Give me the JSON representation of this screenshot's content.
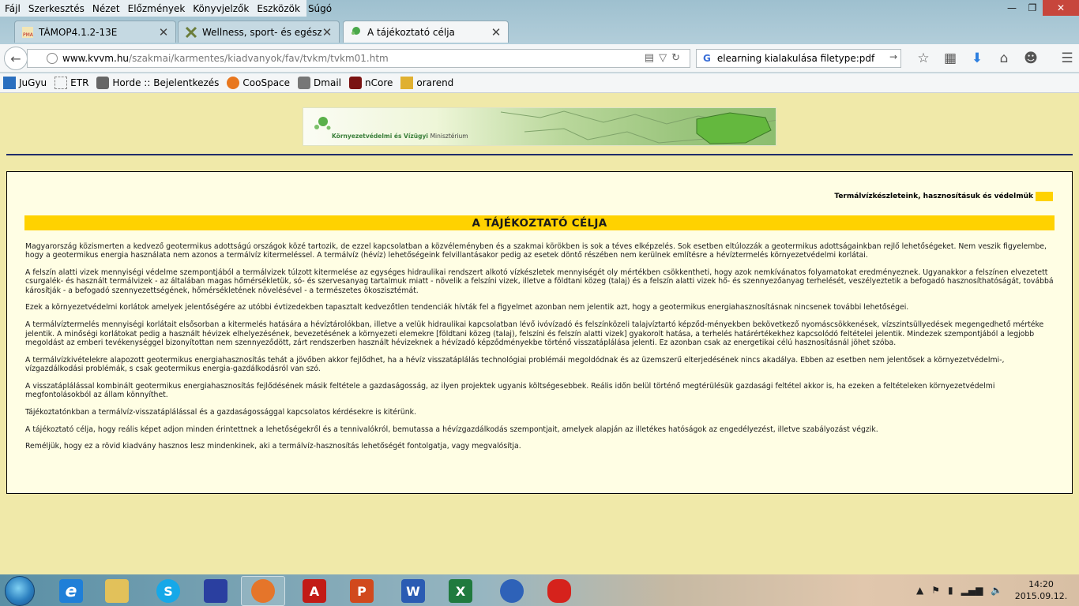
{
  "menu": [
    "Fájl",
    "Szerkesztés",
    "Nézet",
    "Előzmények",
    "Könyvjelzők",
    "Eszközök",
    "Súgó"
  ],
  "window_controls": {
    "minimize": "—",
    "restore": "❐",
    "close": "✕"
  },
  "tabs": [
    {
      "title": "TÁMOP4.1.2-13E",
      "icon": "pma-icon"
    },
    {
      "title": "Wellness, sport- és egészs...",
      "icon": "tools-icon"
    },
    {
      "title": "A tájékoztató célja",
      "icon": "leaf-icon",
      "active": true
    }
  ],
  "new_tab": "+",
  "url": {
    "host": "www.kvvm.hu",
    "path": "/szakmai/karmentes/kiadvanyok/fav/tvkm/tvkm01.htm"
  },
  "search": {
    "engine": "G",
    "value": "elearning kialakulása filetype:pdf",
    "go": "→"
  },
  "nav_icons": [
    "star-icon",
    "bookmarks-list-icon",
    "download-icon",
    "home-icon",
    "chat-icon",
    "menu-icon"
  ],
  "bookmarks": [
    {
      "label": "JuGyu",
      "color": "#2a6fbf"
    },
    {
      "label": "ETR",
      "color": "#ffffff"
    },
    {
      "label": "Horde :: Bejelentkezés",
      "color": "#666666"
    },
    {
      "label": "CooSpace",
      "color": "#e8771e"
    },
    {
      "label": "Dmail",
      "color": "#777777"
    },
    {
      "label": "nCore",
      "color": "#7a1212"
    },
    {
      "label": "orarend",
      "color": "#e0b030"
    }
  ],
  "banner": {
    "ministry": "Környezetvédelmi és Vízügyi",
    "ministry_suffix": "Minisztérium"
  },
  "series_title": "Termálvízkészleteink, hasznosításuk és védelmük",
  "heading": "A TÁJÉKOZTATÓ CÉLJA",
  "paragraphs": [
    "Magyarország közismerten a kedvező geotermikus adottságú országok közé tartozik, de ezzel kapcsolatban a közvéleményben és a szakmai körökben is sok a téves elképzelés. Sok esetben eltúlozzák a geotermikus adottságainkban rejlő lehetőségeket. Nem veszik figyelembe, hogy a geotermikus energia használata nem azonos a termálvíz kitermeléssel. A termálvíz (hévíz) lehetőségeink felvillantásakor pedig az esetek döntő részében nem kerülnek említésre a hévíztermelés környezetvédelmi korlátai.",
    "A felszín alatti vizek mennyiségi védelme szempontjából a termálvizek túlzott kitermelése az egységes hidraulikai rendszert alkotó vízkészletek mennyiségét oly mértékben csökkentheti, hogy azok nemkívánatos folyamatokat eredményeznek. Ugyanakkor a felszínen elvezetett csurgalék- és használt termálvizek - az általában magas hőmérsékletük, só- és szervesanyag tartalmuk miatt - növelik a felszíni vizek, illetve a földtani közeg (talaj) és a felszín alatti vizek hő- és szennyezőanyag terhelését, veszélyeztetik a befogadó hasznosíthatóságát, továbbá károsítják - a befogadó szennyezettségének, hőmérsékletének növelésével - a természetes ökoszisztémát.",
    "Ezek a környezetvédelmi korlátok  amelyek jelentőségére az utóbbi évtizedekben tapasztalt kedvezőtlen tendenciák hívták fel a figyelmet  azonban nem jelentik azt, hogy a geotermikus energiahasznosításnak nincsenek további lehetőségei.",
    "A termálvíztermelés mennyiségi korlátait elsősorban a kitermelés hatására a hévíztárolókban, illetve a velük hidraulikai kapcsolatban lévő ivóvízadó és felszínközeli talajvíztartó képződ-ményekben bekövetkező nyomáscsökkenések, vízszintsüllyedések megengedhető mértéke jelentik. A minőségi korlátokat pedig a használt hévizek elhelyezésének, bevezetésének a környezeti elemekre [földtani közeg (talaj), felszíni és felszín alatti vizek] gyakorolt hatása, a terhelés határértékekhez kapcsolódó feltételei jelentik. Mindezek szempontjából a legjobb megoldást az emberi tevékenységgel bizonyítottan nem szennyeződött, zárt rendszerben használt hévizeknek a hévízadó képződményekbe történő visszatáplálása jelenti. Ez azonban csak az energetikai célú hasznosításnál jöhet szóba.",
    "A termálvízkivételekre alapozott geotermikus energiahasznosítás tehát a jövőben akkor fejlődhet, ha a hévíz visszatáplálás technológiai problémái megoldódnak és az üzemszerű elterjedésének nincs akadálya. Ebben az esetben nem jelentősek a környezetvédelmi-, vízgazdálkodási problémák, s csak geotermikus energia-gazdálkodásról van szó.",
    "A visszatáplálással kombinált geotermikus energiahasznosítás fejlődésének másik feltétele a gazdaságosság, az ilyen projektek ugyanis költségesebbek. Reális időn belül történő megtérülésük gazdasági feltétel akkor is, ha ezeken a feltételeken környezetvédelmi megfontolásokból az állam könnyíthet.",
    "Tájékoztatónkban a termálvíz-visszatáplálással és a gazdaságossággal kapcsolatos kérdésekre is kitérünk.",
    "A tájékoztató célja, hogy reális képet adjon minden érintettnek a lehetőségekről és a tennivalókról, bemutassa a hévízgazdálkodás szempontjait, amelyek alapján az illetékes hatóságok az engedélyezést, illetve szabályozást végzik.",
    "Reméljük, hogy ez a rövid kiadvány hasznos lesz mindenkinek, aki a termálvíz-hasznosítás lehetőségét fontolgatja, vagy megvalósítja."
  ],
  "taskbar": {
    "apps": [
      {
        "name": "ie-icon",
        "label": "e",
        "color": "#1f7fd8"
      },
      {
        "name": "explorer-icon",
        "label": "",
        "color": "#e2c15a"
      },
      {
        "name": "skype-icon",
        "label": "S",
        "color": "#16a8e8"
      },
      {
        "name": "save-disk-icon",
        "label": "",
        "color": "#2a3fa0"
      },
      {
        "name": "firefox-icon",
        "label": "",
        "color": "#e5752a",
        "open": true
      },
      {
        "name": "acrobat-icon",
        "label": "A",
        "color": "#c21b16"
      },
      {
        "name": "powerpoint-icon",
        "label": "P",
        "color": "#d1491d"
      },
      {
        "name": "word-icon",
        "label": "W",
        "color": "#2a5bb3"
      },
      {
        "name": "excel-icon",
        "label": "X",
        "color": "#207a3e"
      },
      {
        "name": "sync-icon",
        "label": "",
        "color": "#2e62b8"
      },
      {
        "name": "splat-icon",
        "label": "",
        "color": "#d6221c"
      }
    ],
    "tray": [
      "▲",
      "⚑",
      "▮",
      "▂▄▆",
      "🔈"
    ],
    "time": "14:20",
    "date": "2015.09.12."
  }
}
